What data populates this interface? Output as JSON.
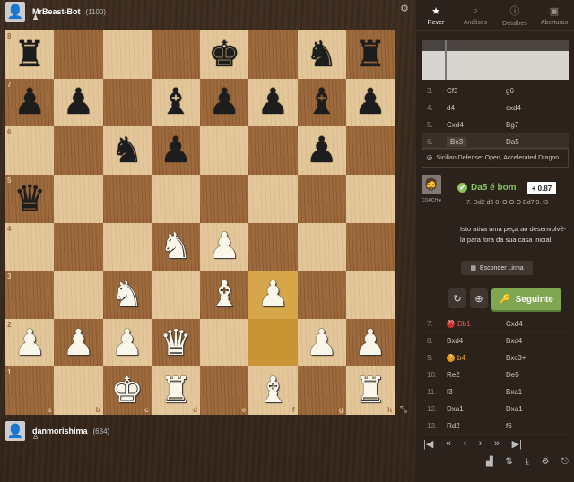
{
  "players": {
    "top": {
      "name": "MrBeast-Bot",
      "rating": "(1100)"
    },
    "bottom": {
      "name": "danmorishima",
      "rating": "(634)"
    }
  },
  "board": {
    "files": [
      "a",
      "b",
      "c",
      "d",
      "e",
      "f",
      "g",
      "h"
    ],
    "ranks": [
      "8",
      "7",
      "6",
      "5",
      "4",
      "3",
      "2",
      "1"
    ],
    "position": [
      [
        "bR",
        "",
        "",
        "",
        "bK",
        "",
        "bN",
        "bR"
      ],
      [
        "bP",
        "bP",
        "",
        "bB",
        "bP",
        "bP",
        "bB",
        "bP"
      ],
      [
        "",
        "",
        "bN",
        "bP",
        "",
        "",
        "bP",
        ""
      ],
      [
        "bQ",
        "",
        "",
        "",
        "",
        "",
        "",
        ""
      ],
      [
        "",
        "",
        "",
        "wN",
        "wP",
        "",
        "",
        ""
      ],
      [
        "",
        "",
        "wN",
        "",
        "wB",
        "wP",
        "",
        ""
      ],
      [
        "wP",
        "wP",
        "wP",
        "wQ",
        "",
        "",
        "wP",
        "wP"
      ],
      [
        "",
        "",
        "wK",
        "wR",
        "",
        "wB",
        "",
        "wR"
      ]
    ],
    "highlight": [
      "f3",
      "f2"
    ]
  },
  "tabs": [
    {
      "label": "Rever",
      "icon": "star-icon",
      "active": true
    },
    {
      "label": "Análises",
      "icon": "magnifier-icon",
      "active": false
    },
    {
      "label": "Detalhes",
      "icon": "info-icon",
      "active": false
    },
    {
      "label": "Aberturas",
      "icon": "book-icon",
      "active": false
    }
  ],
  "moves_top": [
    {
      "n": "3.",
      "w": "Cf3",
      "b": "g6"
    },
    {
      "n": "4.",
      "w": "d4",
      "b": "cxd4"
    },
    {
      "n": "5.",
      "w": "Cxd4",
      "b": "Bg7"
    },
    {
      "n": "6.",
      "w": "Be3",
      "b": "Da5",
      "selected": true
    }
  ],
  "opening": "Sicilian Defense: Open, Accelerated Dragon",
  "coach": {
    "label": "COACH ▾",
    "move": "Da5 é bom",
    "eval": "+ 0.87",
    "line": "7. Dd2 d6 8. O-O-O Bd7 9. f3",
    "explanation": "Isto ativa uma peça ao desenvolvê-la para fora da sua casa inicial.",
    "hide_label": "Esconder Linha"
  },
  "next_label": "Seguinte",
  "moves_bottom": [
    {
      "n": "7.",
      "w": "Db1",
      "b": "Cxd4",
      "tag": "??"
    },
    {
      "n": "8.",
      "w": "Bxd4",
      "b": "Bxd4"
    },
    {
      "n": "9.",
      "w": "b4",
      "b": "Bxc3+",
      "tag": "?"
    },
    {
      "n": "10.",
      "w": "Re2",
      "b": "De5"
    },
    {
      "n": "11.",
      "w": "f3",
      "b": "Bxa1"
    },
    {
      "n": "12.",
      "w": "Dxa1",
      "b": "Dxa1"
    },
    {
      "n": "13.",
      "w": "Rd2",
      "b": "f6"
    }
  ]
}
